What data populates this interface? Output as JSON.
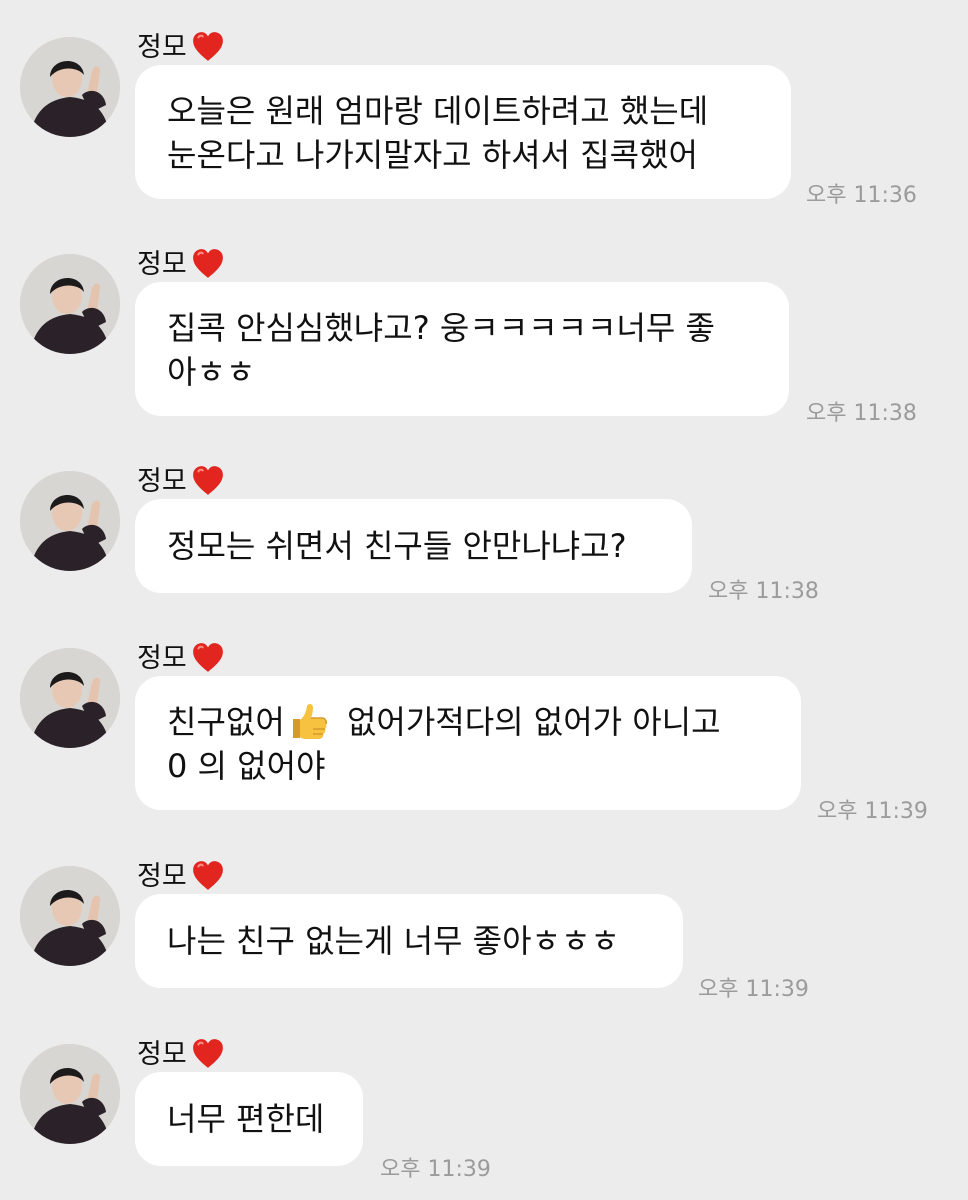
{
  "sender": {
    "name": "정모",
    "badge_icon": "red-heart-icon",
    "avatar_icon": "profile-photo"
  },
  "messages": [
    {
      "lines": [
        "오늘은 원래 엄마랑 데이트하려고 했는데",
        "눈온다고 나가지말자고 하셔서 집콕했어"
      ],
      "time": "오후 11:36"
    },
    {
      "lines": [
        "집콕 안심심했냐고? 웅ㅋㅋㅋㅋㅋ너무 좋",
        "아ㅎㅎ"
      ],
      "time": "오후 11:38"
    },
    {
      "lines": [
        "정모는 쉬면서 친구들 안만나냐고?"
      ],
      "time": "오후 11:38"
    },
    {
      "line_before_emoji": "친구없어",
      "emoji_icon": "thumbs-up-icon",
      "line_after_emoji": " 없어가적다의 없어가 아니고",
      "lines": [
        "0 의 없어야"
      ],
      "time": "오후 11:39"
    },
    {
      "lines": [
        "나는 친구 없는게 너무 좋아ㅎㅎㅎ"
      ],
      "time": "오후 11:39"
    },
    {
      "lines": [
        "너무 편한데"
      ],
      "time": "오후 11:39"
    }
  ]
}
